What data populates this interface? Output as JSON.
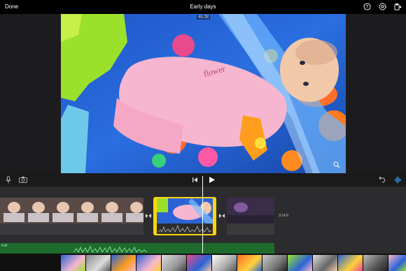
{
  "header": {
    "done_label": "Done",
    "project_title": "Early days",
    "icons": [
      "help-icon",
      "settings-icon",
      "share-icon"
    ]
  },
  "viewer": {
    "timecode": "45.28",
    "fullscreen_icon": "zoom-icon"
  },
  "controls": {
    "icons": [
      "microphone-icon",
      "camera-icon",
      "skip-back-icon",
      "play-icon",
      "undo-icon",
      "audio-waveform-icon"
    ]
  },
  "timeline": {
    "clip_duration": "3:14.9",
    "audio_track_label": "Full",
    "selected_clip_color": "#ffd60a",
    "audio_color": "#2ea043"
  },
  "filmstrip": {
    "thumbnail_count": 15
  }
}
